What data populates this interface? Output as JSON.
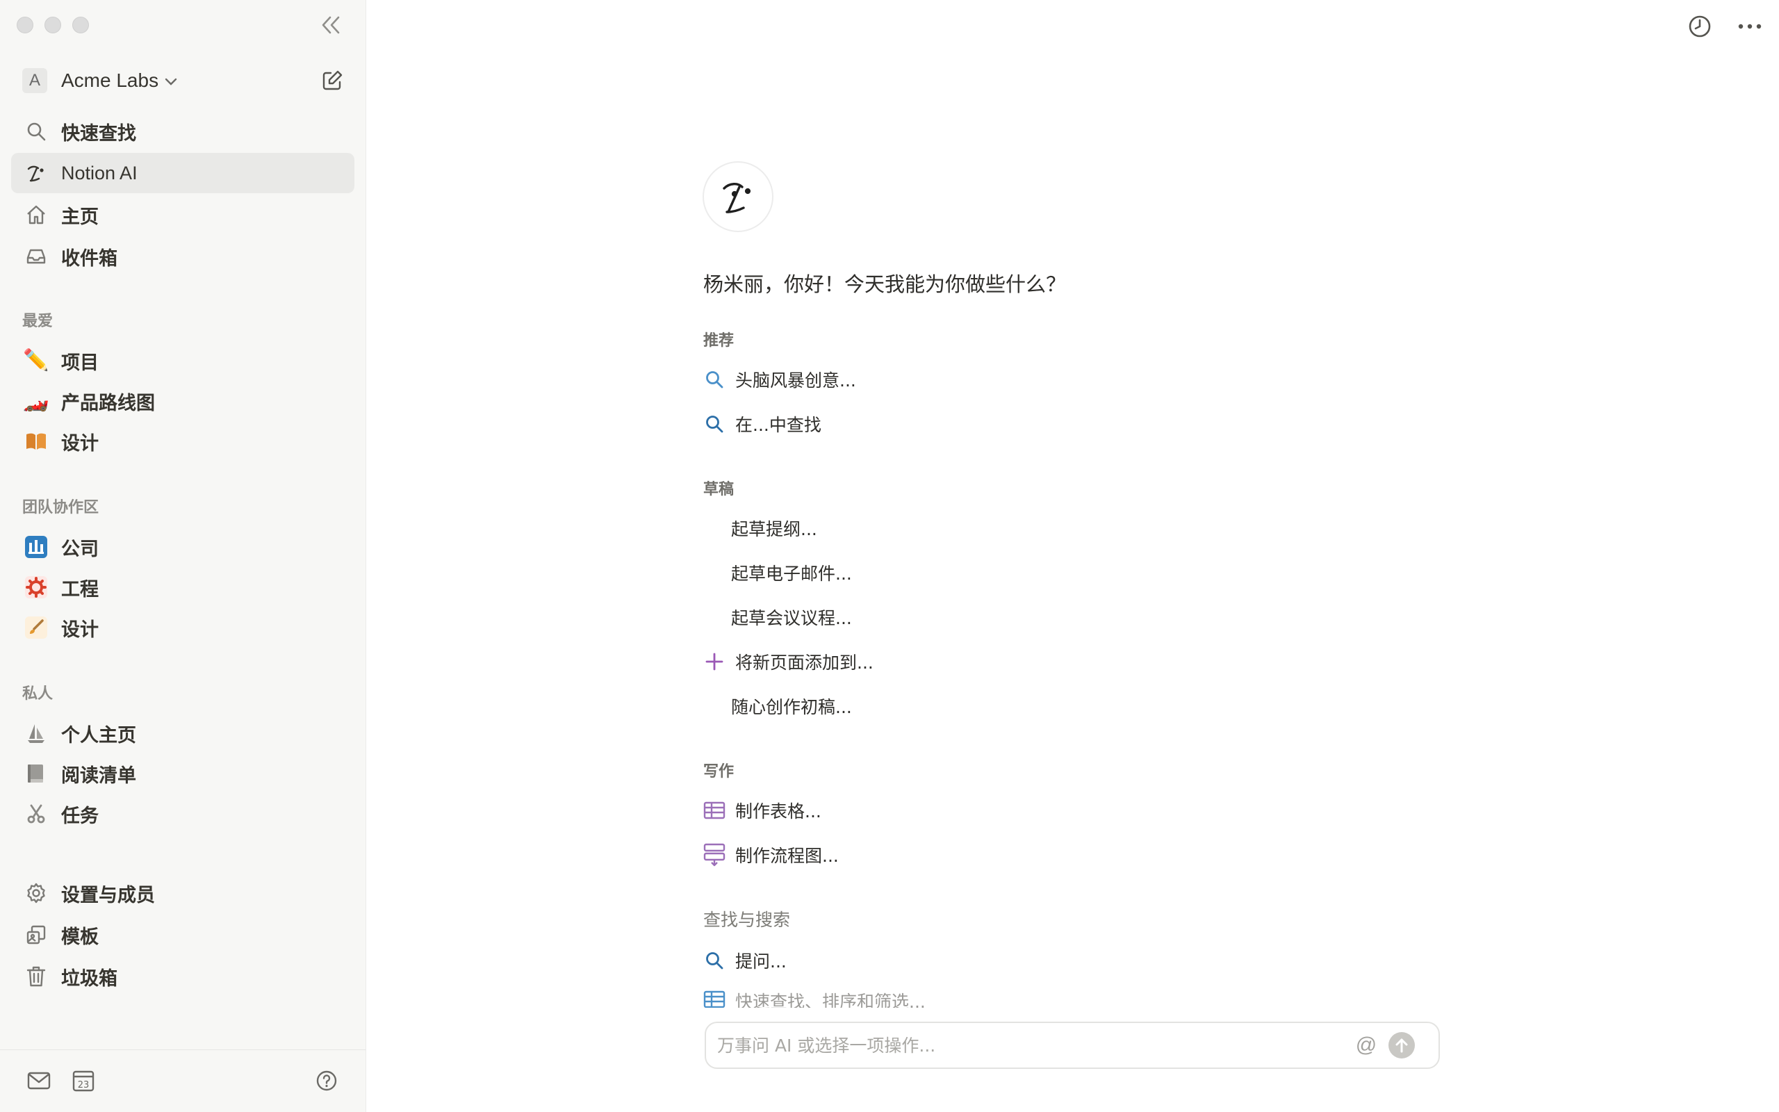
{
  "workspace": {
    "avatar_letter": "A",
    "name": "Acme Labs"
  },
  "nav": [
    {
      "label": "快速查找",
      "icon": "search-icon"
    },
    {
      "label": "Notion AI",
      "icon": "notion-ai-icon",
      "active": true
    },
    {
      "label": "主页",
      "icon": "home-icon"
    },
    {
      "label": "收件箱",
      "icon": "inbox-icon"
    }
  ],
  "favorites": {
    "title": "最爱",
    "items": [
      {
        "label": "项目",
        "icon": "pencil-icon"
      },
      {
        "label": "产品路线图",
        "icon": "racing-car-icon"
      },
      {
        "label": "设计",
        "icon": "book-icon"
      }
    ]
  },
  "teamspaces": {
    "title": "团队协作区",
    "items": [
      {
        "label": "公司",
        "icon": "company-icon"
      },
      {
        "label": "工程",
        "icon": "gear-red-icon"
      },
      {
        "label": "设计",
        "icon": "brush-icon"
      }
    ]
  },
  "private": {
    "title": "私人",
    "items": [
      {
        "label": "个人主页",
        "icon": "sailboat-icon"
      },
      {
        "label": "阅读清单",
        "icon": "book-gray-icon"
      },
      {
        "label": "任务",
        "icon": "scissors-icon"
      }
    ]
  },
  "bottom_nav": [
    {
      "label": "设置与成员",
      "icon": "gear-icon"
    },
    {
      "label": "模板",
      "icon": "templates-icon"
    },
    {
      "label": "垃圾箱",
      "icon": "trash-icon"
    }
  ],
  "footer": {
    "calendar_day": "23"
  },
  "main": {
    "greeting": "杨米丽，你好！今天我能为你做些什么？",
    "groups": {
      "recommended": {
        "title": "推荐",
        "items": [
          "头脑风暴创意...",
          "在...中查找"
        ]
      },
      "drafts": {
        "title": "草稿",
        "items": [
          "起草提纲...",
          "起草电子邮件...",
          "起草会议议程...",
          "将新页面添加到...",
          "随心创作初稿..."
        ]
      },
      "writing": {
        "title": "写作",
        "items": [
          "制作表格...",
          "制作流程图..."
        ]
      },
      "find": {
        "title": "查找与搜索",
        "items": [
          "提问...",
          "快速查找、排序和筛选..."
        ]
      }
    },
    "prompt": {
      "placeholder": "万事问 AI 或选择一项操作...",
      "value": "",
      "at_symbol": "@"
    }
  },
  "colors": {
    "accent_blue": "#3b82c4",
    "accent_purple": "#9b59b6",
    "sidebar_bg": "#f7f7f5"
  }
}
